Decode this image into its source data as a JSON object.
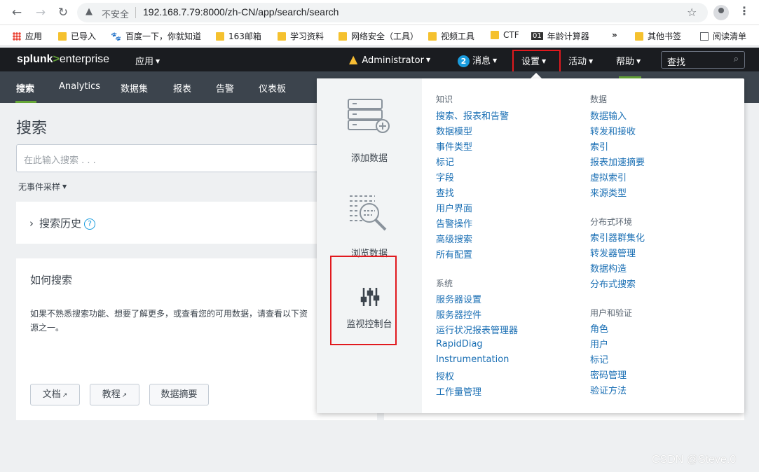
{
  "browser": {
    "security_label": "不安全",
    "url": "192.168.7.79:8000/zh-CN/app/search/search",
    "bookmarks": [
      "应用",
      "已导入",
      "百度一下，你就知道",
      "163邮箱",
      "学习资料",
      "网络安全（工具）",
      "视频工具",
      "CTF",
      "年龄计算器",
      "»",
      "其他书签",
      "阅读清单"
    ],
    "ol_badge": "01"
  },
  "topbar": {
    "logo_splunk": "splunk",
    "logo_gt": ">",
    "logo_enterprise": "enterprise",
    "apps_menu": "应用",
    "user": "Administrator",
    "messages_count": "2",
    "messages": "消息",
    "settings": "设置",
    "activity": "活动",
    "help": "帮助",
    "find_placeholder": "查找"
  },
  "appbar": {
    "items": [
      "搜索",
      "Analytics",
      "数据集",
      "报表",
      "告警",
      "仪表板"
    ]
  },
  "main": {
    "title": "搜索",
    "search_placeholder": "在此输入搜索 . . .",
    "sampling": "无事件采样",
    "history_title": "搜索历史",
    "history_help": "?",
    "how_title": "如何搜索",
    "how_text": "如果不熟悉搜索功能、想要了解更多，或查看您的可用数据，请查看以下资源之一。",
    "buttons": [
      "文档",
      "教程",
      "数据摘要"
    ]
  },
  "settings_menu": {
    "left": [
      "添加数据",
      "浏览数据",
      "监视控制台"
    ],
    "col1": {
      "knowledge_head": "知识",
      "knowledge": [
        "搜索、报表和告警",
        "数据模型",
        "事件类型",
        "标记",
        "字段",
        "查找",
        "用户界面",
        "告警操作",
        "高级搜索",
        "所有配置"
      ],
      "system_head": "系统",
      "system": [
        "服务器设置",
        "服务器控件",
        "运行状况报表管理器",
        "RapidDiag",
        "Instrumentation",
        "授权",
        "工作量管理"
      ]
    },
    "col2": {
      "data_head": "数据",
      "data": [
        "数据输入",
        "转发和接收",
        "索引",
        "报表加速摘要",
        "虚拟索引",
        "来源类型"
      ],
      "dist_head": "分布式环境",
      "dist": [
        "索引器群集化",
        "转发器管理",
        "数据构造",
        "分布式搜索"
      ],
      "users_head": "用户和验证",
      "users": [
        "角色",
        "用户",
        "标记",
        "密码管理",
        "验证方法"
      ]
    }
  },
  "watermark": "CSDN @Steve.0",
  "colors": {
    "accent_green": "#65a637",
    "link_blue": "#1a6fb4",
    "highlight_red": "#e1191e"
  }
}
